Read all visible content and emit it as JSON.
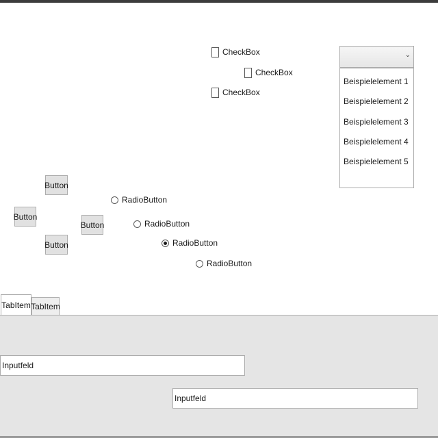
{
  "checkboxes": [
    {
      "label": "CheckBox",
      "checked": false
    },
    {
      "label": "CheckBox",
      "checked": false
    },
    {
      "label": "CheckBox",
      "checked": false
    }
  ],
  "combobox": {
    "selected": "",
    "arrow_icon": "chevron-down-icon"
  },
  "listbox": {
    "items": [
      "Beispielelement 1",
      "Beispielelement 2",
      "Beispielelement 3",
      "Beispielelement 4",
      "Beispielelement 5"
    ]
  },
  "buttons": [
    "Button",
    "Button",
    "Button",
    "Button"
  ],
  "radiobuttons": [
    {
      "label": "RadioButton",
      "checked": false
    },
    {
      "label": "RadioButton",
      "checked": false
    },
    {
      "label": "RadioButton",
      "checked": true
    },
    {
      "label": "RadioButton",
      "checked": false
    }
  ],
  "tabs": [
    {
      "label": "TabItem",
      "active": true
    },
    {
      "label": "TabItem",
      "active": false
    }
  ],
  "inputs": [
    {
      "value": "Inputfeld"
    },
    {
      "value": "Inputfeld"
    }
  ]
}
